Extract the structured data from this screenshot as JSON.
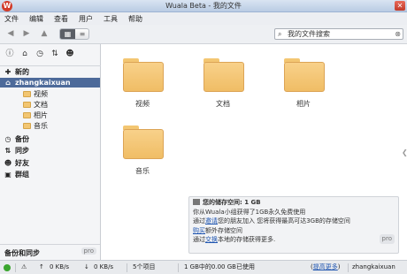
{
  "window": {
    "title": "Wuala Beta - 我的文件",
    "app_icon": "W",
    "close_glyph": "✕"
  },
  "menu": [
    "文件",
    "编辑",
    "查看",
    "用户",
    "工具",
    "帮助"
  ],
  "search": {
    "value": "我的文件搜索",
    "clear_glyph": "⊗"
  },
  "sidebar": {
    "top_icons": [
      "info-icon",
      "home-icon",
      "history-icon",
      "sync-icon",
      "person-icon"
    ],
    "items": [
      {
        "label": "新的",
        "glyph": "✚"
      },
      {
        "label": "zhangkaixuan",
        "glyph": "⌂"
      },
      {
        "label": "视频"
      },
      {
        "label": "文档"
      },
      {
        "label": "相片"
      },
      {
        "label": "音乐"
      },
      {
        "label": "备份",
        "glyph": "◷"
      },
      {
        "label": "同步",
        "glyph": "⇅"
      },
      {
        "label": "好友",
        "glyph": "☻"
      },
      {
        "label": "群组",
        "glyph": "▣"
      }
    ],
    "bottom_label": "备份和同步",
    "bottom_badge": "pro"
  },
  "folders": [
    {
      "label": "视频"
    },
    {
      "label": "文档"
    },
    {
      "label": "相片"
    },
    {
      "label": "音乐"
    }
  ],
  "info_panel": {
    "heading": "您的储存空间: 1 GB",
    "line1": "你从Wuala小组获得了1GB永久免费使用",
    "line2_pre": "通过",
    "line2_link": "邀请",
    "line2_post": "您的朋友加入 您将获得最高可达3GB的存储空间",
    "line3_link": "购买",
    "line3_post": "额外存储空间",
    "line4_pre": "通过",
    "line4_link": "交换",
    "line4_post": "本地的存储获得更多.",
    "badge": "pro"
  },
  "status": {
    "up_speed": "0 KB/s",
    "down_speed": "0 KB/s",
    "items": "5个项目",
    "quota": "1 GB中的0.00 GB已使用",
    "upgrade_link": "提高更多",
    "user": "zhangkaixuan",
    "colors": {
      "online": "#3aa52e",
      "selected": "#4d6a9a",
      "folder": "#f3c672"
    }
  }
}
